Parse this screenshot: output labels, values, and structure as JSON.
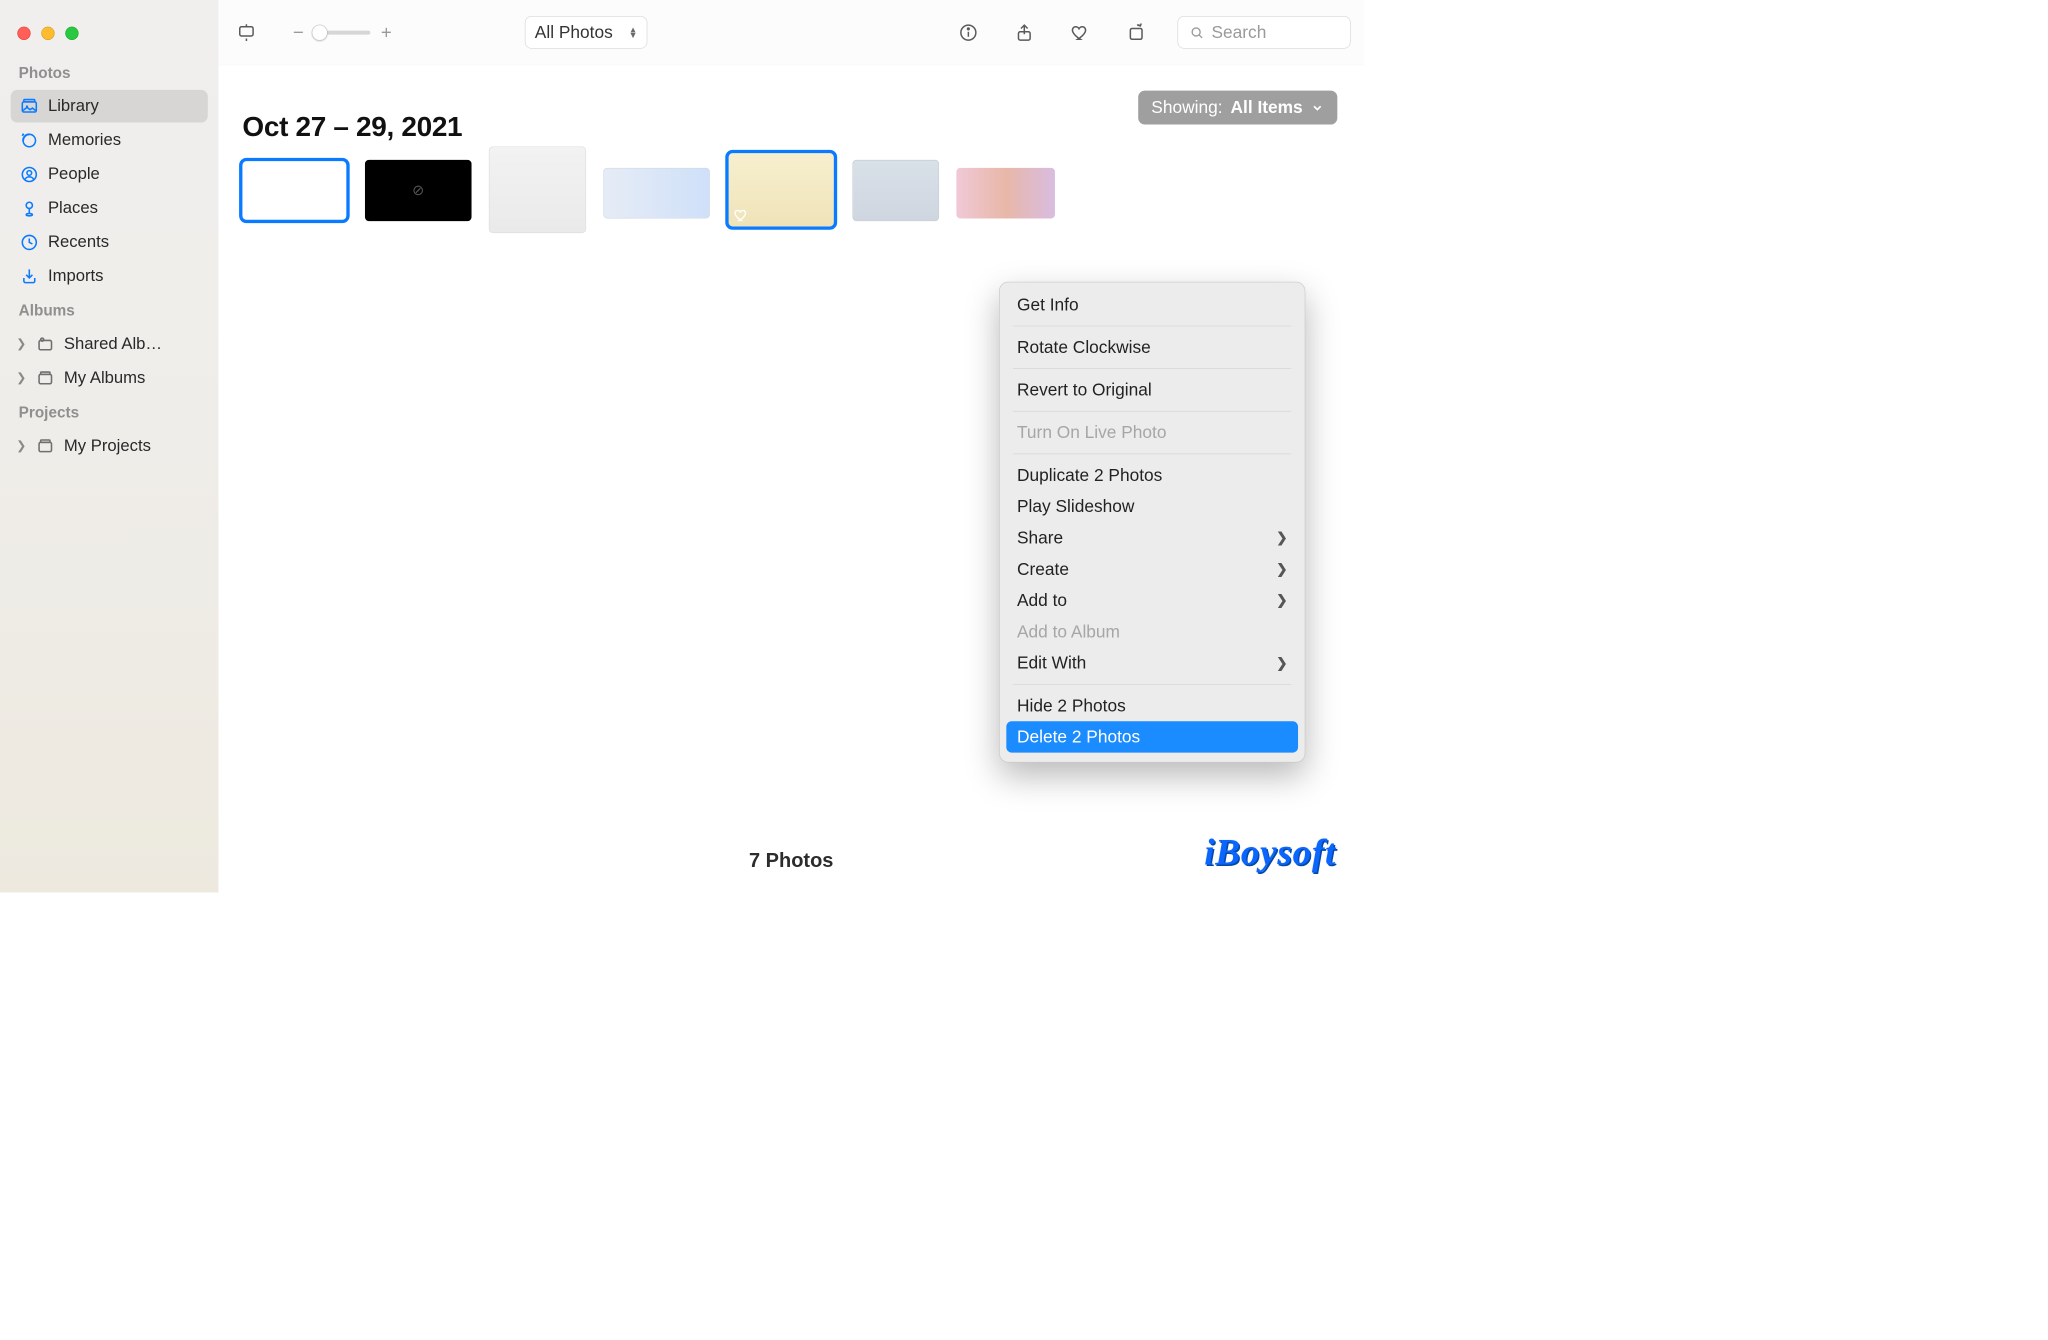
{
  "toolbar": {
    "view_selector": "All Photos",
    "search_placeholder": "Search"
  },
  "showing": {
    "prefix": "Showing:",
    "value": "All Items"
  },
  "content": {
    "date_title": "Oct 27 – 29, 2021",
    "footer_count": "7 Photos"
  },
  "sidebar": {
    "sections": {
      "photos": {
        "header": "Photos",
        "items": [
          {
            "label": "Library",
            "icon": "library"
          },
          {
            "label": "Memories",
            "icon": "memories"
          },
          {
            "label": "People",
            "icon": "people"
          },
          {
            "label": "Places",
            "icon": "places"
          },
          {
            "label": "Recents",
            "icon": "recents"
          },
          {
            "label": "Imports",
            "icon": "imports"
          }
        ]
      },
      "albums": {
        "header": "Albums",
        "items": [
          {
            "label": "Shared Alb…",
            "icon": "shared"
          },
          {
            "label": "My Albums",
            "icon": "album"
          }
        ]
      },
      "projects": {
        "header": "Projects",
        "items": [
          {
            "label": "My Projects",
            "icon": "album"
          }
        ]
      }
    }
  },
  "context_menu": {
    "items": [
      {
        "label": "Get Info",
        "type": "item"
      },
      {
        "type": "sep"
      },
      {
        "label": "Rotate Clockwise",
        "type": "item"
      },
      {
        "type": "sep"
      },
      {
        "label": "Revert to Original",
        "type": "item"
      },
      {
        "type": "sep"
      },
      {
        "label": "Turn On Live Photo",
        "type": "item",
        "disabled": true
      },
      {
        "type": "sep"
      },
      {
        "label": "Duplicate 2 Photos",
        "type": "item"
      },
      {
        "label": "Play Slideshow",
        "type": "item"
      },
      {
        "label": "Share",
        "type": "item",
        "submenu": true
      },
      {
        "label": "Create",
        "type": "item",
        "submenu": true
      },
      {
        "label": "Add to",
        "type": "item",
        "submenu": true
      },
      {
        "label": "Add to Album",
        "type": "item",
        "disabled": true
      },
      {
        "label": "Edit With",
        "type": "item",
        "submenu": true
      },
      {
        "type": "sep"
      },
      {
        "label": "Hide 2 Photos",
        "type": "item"
      },
      {
        "label": "Delete 2 Photos",
        "type": "item",
        "highlight": true
      }
    ]
  },
  "watermark": "iBoysoft",
  "colors": {
    "accent": "#0a7aff",
    "highlight": "#1b8cff"
  }
}
